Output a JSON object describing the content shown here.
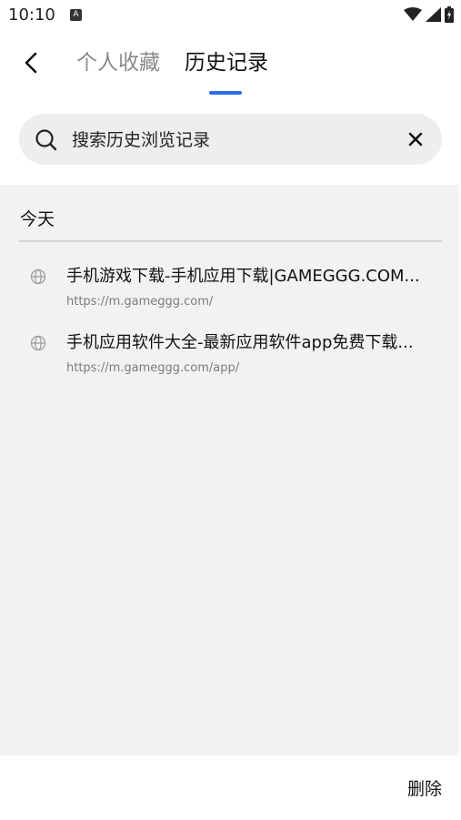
{
  "status_bar": {
    "time": "10:10",
    "notification_icon_letter": "A",
    "icons": [
      "wifi-icon",
      "signal-icon",
      "battery-icon"
    ]
  },
  "header": {
    "tabs": [
      {
        "label": "个人收藏",
        "active": false
      },
      {
        "label": "历史记录",
        "active": true
      }
    ],
    "accent_color": "#2c6ce8"
  },
  "search": {
    "placeholder": "搜索历史浏览记录",
    "value": ""
  },
  "history": {
    "section_title": "今天",
    "items": [
      {
        "title": "手机游戏下载-手机应用下载|GAMEGGG.COM...",
        "url": "https://m.gameggg.com/"
      },
      {
        "title": "手机应用软件大全-最新应用软件app免费下载...",
        "url": "https://m.gameggg.com/app/"
      }
    ]
  },
  "footer": {
    "delete_label": "删除"
  }
}
